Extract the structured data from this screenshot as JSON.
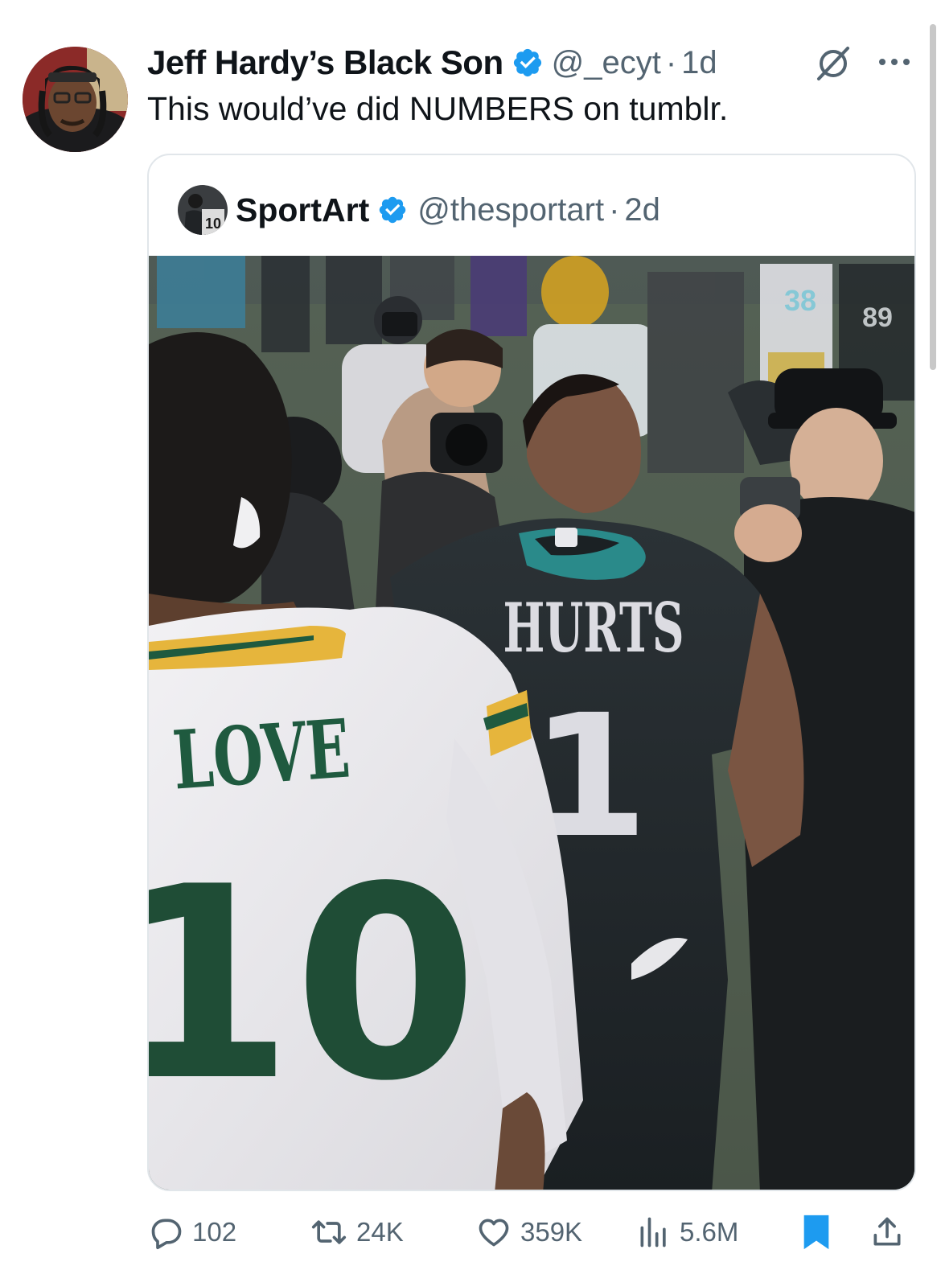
{
  "tweet": {
    "author": {
      "display_name": "Jeff Hardy’s Black Son",
      "handle": "@_ecyt",
      "time": "1d",
      "dot": "·"
    },
    "text": "This would’ve did NUMBERS on tumblr."
  },
  "quote": {
    "author": {
      "display_name": "SportArt",
      "handle": "@thesportart",
      "time": "2d",
      "dot": "·"
    },
    "image": {
      "jersey_left_name": "LOVE",
      "jersey_left_number": "10",
      "jersey_right_name": "HURTS",
      "jersey_right_number": "1",
      "background_numbers": [
        "38",
        "89"
      ],
      "avatar_number": "10"
    }
  },
  "actions": {
    "replies": "102",
    "reposts": "24K",
    "likes": "359K",
    "views": "5.6M"
  },
  "colors": {
    "verified": "#1d9bf0",
    "bookmark": "#1d9bf0",
    "secondary_text": "#536471",
    "packers_green": "#1f5a3f",
    "packers_gold": "#e6b53c",
    "eagles_midnight": "#1c2326",
    "eagles_teal": "#2a8a8a"
  }
}
